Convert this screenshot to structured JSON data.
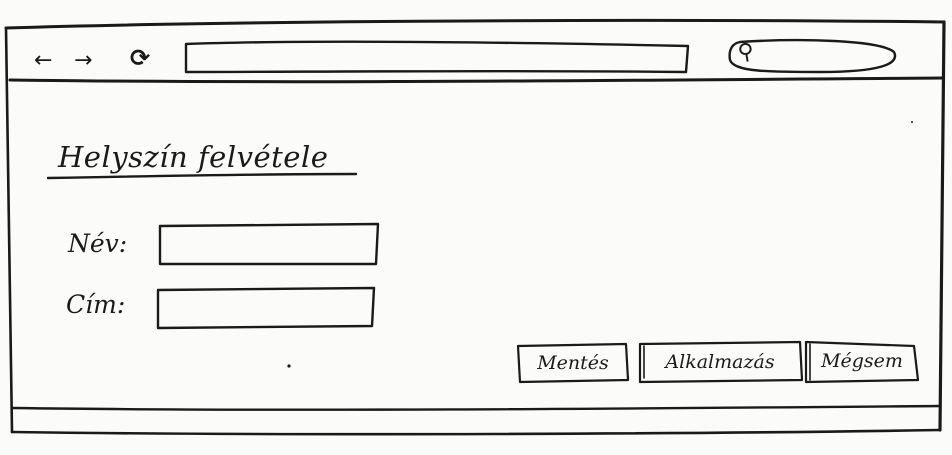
{
  "browser": {
    "back_label": "←",
    "forward_label": "→",
    "reload_label": "⟳",
    "address_value": "",
    "search_value": ""
  },
  "form": {
    "title": "Helyszín felvétele",
    "name_label": "Név:",
    "name_value": "",
    "address_label": "Cím:",
    "address_value": ""
  },
  "actions": {
    "save_label": "Mentés",
    "apply_label": "Alkalmazás",
    "cancel_label": "Mégsem"
  }
}
